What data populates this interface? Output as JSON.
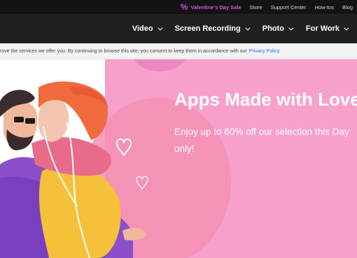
{
  "topbar": {
    "sale_icon": "percent-icon",
    "sale_label": "Valentine's Day Sale",
    "links": [
      "Store",
      "Support Center",
      "How-tos",
      "Blog"
    ]
  },
  "nav": {
    "items": [
      "Video",
      "Screen Recording",
      "Photo",
      "For Work"
    ]
  },
  "cookie": {
    "text": "rove the services we offer you. By continuing to browse this site, you consent to keep them in accordance with our",
    "link": "Privacy Policy."
  },
  "hero": {
    "title": "Apps Made with Love",
    "subtitle": "Enjoy up to 60% off our selection this Day only!"
  },
  "colors": {
    "accent": "#d15be0",
    "hero_pink": "#f7a0cc",
    "nav_bg": "#202020"
  }
}
